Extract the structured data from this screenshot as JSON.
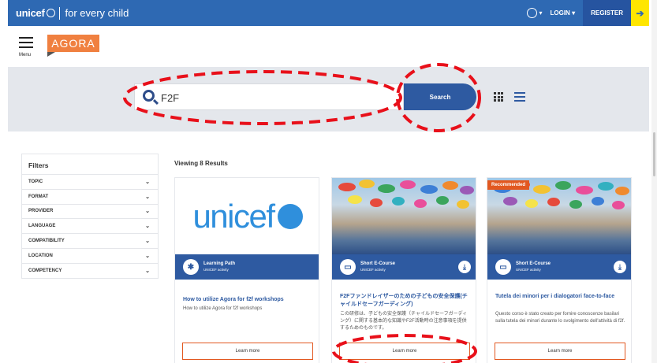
{
  "topbar": {
    "brand": "unicef",
    "tagline": "for every child",
    "login": "LOGIN",
    "register": "REGISTER"
  },
  "header": {
    "menu_label": "Menu",
    "logo_text": "AGORA"
  },
  "search": {
    "value": "F2F",
    "button_label": "Search"
  },
  "filters": {
    "title": "Filters",
    "items": [
      "TOPIC",
      "FORMAT",
      "PROVIDER",
      "LANGUAGE",
      "COMPATIBILITY",
      "LOCATION",
      "COMPETENCY"
    ]
  },
  "results": {
    "label": "Viewing 8 Results"
  },
  "cards": [
    {
      "media_logo": "unicef",
      "type": "Learning Path",
      "provider": "UNICEF activity",
      "title": "How to utilize Agora for f2f workshops",
      "description": "How to utilize Agora for f2f workshops",
      "button": "Learn more"
    },
    {
      "type": "Short E-Course",
      "provider": "UNICEF activity",
      "title": "F2Fファンドレイザーのための子どもの安全保護(チャイルドセーフガーディング)",
      "description": "この研修は、子どもの安全保護（チャイルドセーフガーディング）に関する基本的な知識やF2F活動時の注意事項を提供するためのものです。",
      "button": "Learn more"
    },
    {
      "badge": "Recommended",
      "type": "Short E-Course",
      "provider": "UNICEF activity",
      "title": "Tutela dei minori per i dialogatori face-to-face",
      "description": "Questo corso è stato creato per fornire conoscenze basilari sulla tutela dei minori durante lo svolgimento dell'attività di f2f.",
      "button": "Learn more"
    }
  ],
  "colors": {
    "primary_blue": "#2e5aa1",
    "topbar_blue": "#2e69b3",
    "accent_orange": "#e25820",
    "agora_orange": "#f08040",
    "annotation_red": "#e8101a",
    "highlight_yellow": "#ffe600"
  }
}
